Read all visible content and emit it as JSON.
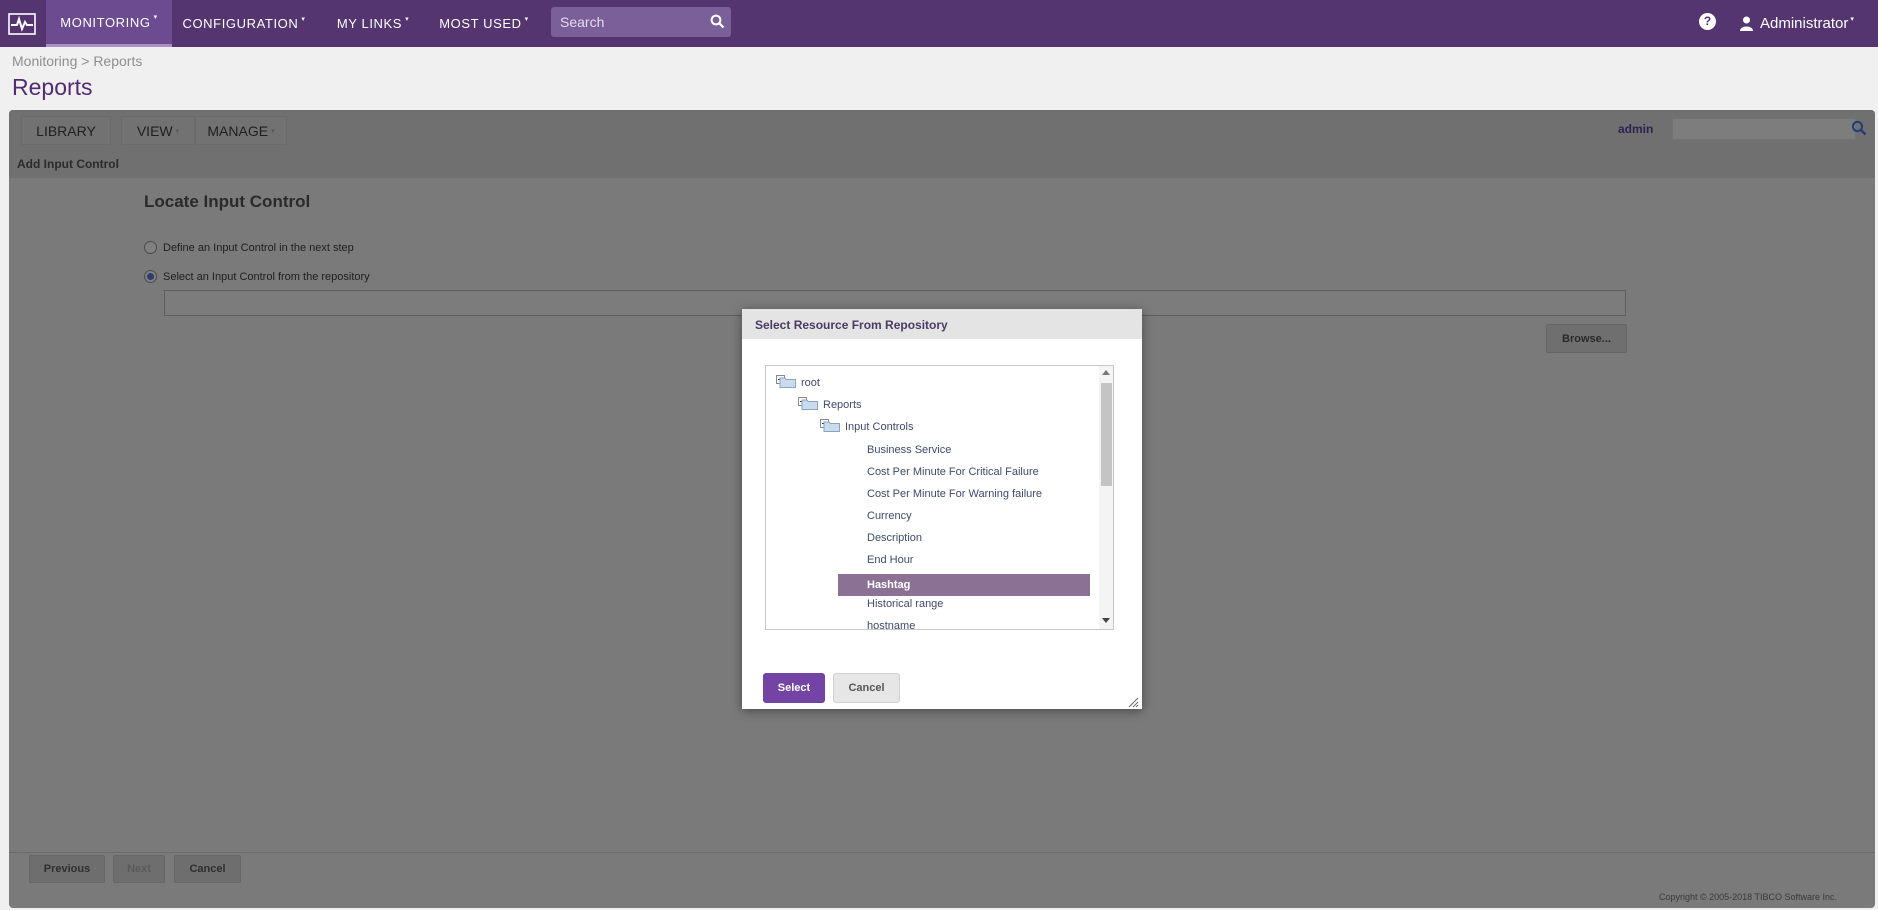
{
  "nav": {
    "items": [
      {
        "label": "MONITORING"
      },
      {
        "label": "CONFIGURATION"
      },
      {
        "label": "MY LINKS"
      },
      {
        "label": "MOST USED"
      }
    ],
    "search_placeholder": "Search",
    "user": "Administrator",
    "help": "?",
    "caret": "▾"
  },
  "breadcrumb": "Monitoring > Reports",
  "title": "Reports",
  "toolbar": {
    "library": "LIBRARY",
    "view": "VIEW",
    "manage": "MANAGE",
    "user": "admin"
  },
  "sub_title": "Add Input Control",
  "wizard": {
    "heading": "Locate Input Control",
    "option_define": "Define an Input Control in the next step",
    "option_select": "Select an Input Control from the repository",
    "selected_option": "select",
    "repo_path": "",
    "browse": "Browse..."
  },
  "footer": {
    "previous": "Previous",
    "next": "Next",
    "cancel": "Cancel",
    "copyright": "Copyright © 2005-2018 TIBCO Software Inc."
  },
  "dialog": {
    "title": "Select Resource From Repository",
    "tree": [
      {
        "label": "root",
        "type": "folder"
      },
      {
        "label": "Reports",
        "type": "folder"
      },
      {
        "label": "Input Controls",
        "type": "folder"
      },
      {
        "label": "Business Service",
        "type": "item"
      },
      {
        "label": "Cost Per Minute For Critical Failure",
        "type": "item"
      },
      {
        "label": "Cost Per Minute For Warning failure",
        "type": "item"
      },
      {
        "label": "Currency",
        "type": "item"
      },
      {
        "label": "Description",
        "type": "item"
      },
      {
        "label": "End Hour",
        "type": "item"
      },
      {
        "label": "Hashtag",
        "type": "item",
        "selected": true
      },
      {
        "label": "Historical range",
        "type": "item"
      },
      {
        "label": "hostname",
        "type": "item"
      }
    ],
    "select": "Select",
    "cancel": "Cancel"
  },
  "colors": {
    "nav_bg": "#54356f",
    "accent": "#7444a4",
    "selection": "#8b7295"
  }
}
